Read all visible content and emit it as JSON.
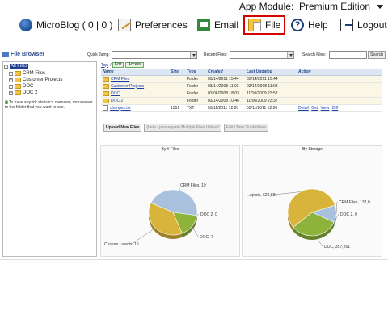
{
  "app": {
    "module_label": "App Module:",
    "module_value": "Premium Edition"
  },
  "nav": [
    {
      "label": "MicroBlog ( 0 | 0 )",
      "icon": "microblog-icon"
    },
    {
      "label": "Preferences",
      "icon": "preferences-icon"
    },
    {
      "label": "Email",
      "icon": "email-icon"
    },
    {
      "label": "File",
      "icon": "file-icon",
      "active": true
    },
    {
      "label": "Help",
      "icon": "help-icon"
    },
    {
      "label": "Logout",
      "icon": "logout-icon"
    }
  ],
  "file_browser": {
    "title": "File Browser",
    "quick_jump_label": "Quick Jump:",
    "recent_files_label": "Recent Files:",
    "search_label": "Search Files:",
    "search_button": "Search"
  },
  "tree": {
    "root": "All Files",
    "items": [
      "CRM Files",
      "Customer Projects",
      "DOC",
      "DOC 2"
    ],
    "hint": "To have a quick statistics overview, mouseover to the folder that you want to see."
  },
  "crumbs": {
    "top": "Top",
    "sep": "/",
    "edit": "Edit",
    "access": "Access"
  },
  "table": {
    "headers": [
      "Name",
      "Size",
      "Type",
      "Created",
      "Last Updated",
      "Action"
    ],
    "rows": [
      {
        "name": "CRM Files",
        "size": "",
        "type": "Folder",
        "created": "03/14/2011 15:44",
        "updated": "03/14/2011 15:44",
        "kind": "folder"
      },
      {
        "name": "Customer Projects",
        "size": "",
        "type": "Folder",
        "created": "03/14/2008 11:03",
        "updated": "03/14/2008 11:03",
        "kind": "folder"
      },
      {
        "name": "DOC",
        "size": "",
        "type": "Folder",
        "created": "03/06/2008 18:03",
        "updated": "11/10/2009 23:52",
        "kind": "folder"
      },
      {
        "name": "DOC 2",
        "size": "",
        "type": "Folder",
        "created": "03/14/2008 10:46",
        "updated": "11/06/2009 23:37",
        "kind": "folder"
      },
      {
        "name": "changes.txt",
        "size": "1351",
        "type": "TXT",
        "created": "03/11/2011 12:20",
        "updated": "03/11/2011 12:20",
        "kind": "file"
      }
    ],
    "file_actions": [
      "Detail",
      "Get",
      "View",
      "Diff"
    ]
  },
  "actions": {
    "upload": "Upload New Files",
    "multi": "(beta / java applet) Multiple Files Upload",
    "edit": "Edit / New SubFolders"
  },
  "chart_data": [
    {
      "type": "pie",
      "title": "By # Files",
      "categories": [
        "CRM Files",
        "DOC 2",
        "DOC",
        "Custom...ojects"
      ],
      "values": [
        19,
        0,
        7,
        16
      ],
      "labels": [
        "CRM Files, 19",
        "DOC 2, 0",
        "DOC, 7",
        "Custom...ojects, 16"
      ],
      "colors": [
        "#a9c1dc",
        "#4a8fc8",
        "#8db33a",
        "#d9b43b"
      ]
    },
    {
      "type": "pie",
      "title": "By Storage",
      "categories": [
        "CRM Files",
        "DOC 2",
        "DOC",
        "Custom...ojects"
      ],
      "values": [
        132000,
        0,
        357261,
        620881
      ],
      "labels": [
        "CRM Files, 132,0",
        "DOC 2, 0",
        "DOC, 357,261",
        "...ojects, 620,881"
      ],
      "colors": [
        "#a9c1dc",
        "#4a8fc8",
        "#8db33a",
        "#d9b43b"
      ]
    }
  ]
}
